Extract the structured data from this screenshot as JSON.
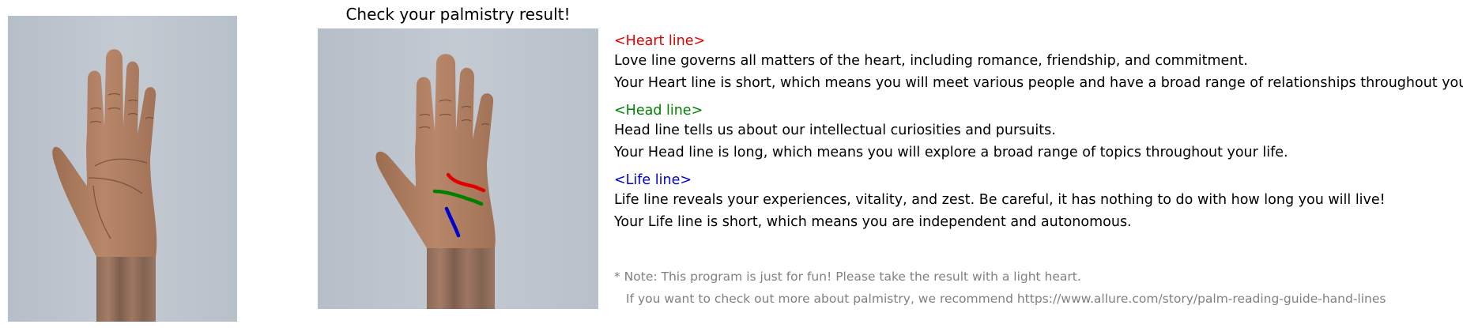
{
  "title": "Check your palmistry result!",
  "colors": {
    "heart_line": "#e00000",
    "head_line": "#008000",
    "life_line": "#0000cc",
    "note_text": "#808080",
    "photo_background": "#b9c1c9",
    "skin": "#b07f60"
  },
  "images": {
    "original": {
      "name": "hand-photo-icon",
      "description": "palm photo"
    },
    "annotated": {
      "name": "annotated-palm-icon",
      "description": "palm photo with detected lines"
    }
  },
  "lines": [
    {
      "key": "heart",
      "heading": "<Heart line>",
      "color": "#e00000",
      "description": "Love line governs all matters of the heart, including romance, friendship, and commitment.",
      "result": "Your Heart line is short, which means you will meet various people and have a broad range of relationships throughout your life."
    },
    {
      "key": "head",
      "heading": "<Head line>",
      "color": "#008000",
      "description": "Head line tells us about our intellectual curiosities and pursuits.",
      "result": "Your Head line is long, which means you will explore a broad range of topics throughout your life."
    },
    {
      "key": "life",
      "heading": "<Life line>",
      "color": "#0000cc",
      "description": "Life line reveals your experiences, vitality, and zest. Be careful, it has nothing to do with how long you will live!",
      "result": "Your Life line is short, which means you are independent and autonomous."
    }
  ],
  "notes": {
    "note": "* Note: This program is just for fun! Please take the result with a light heart.",
    "link_text": "If you want to check out more about palmistry, we recommend https://www.allure.com/story/palm-reading-guide-hand-lines"
  }
}
